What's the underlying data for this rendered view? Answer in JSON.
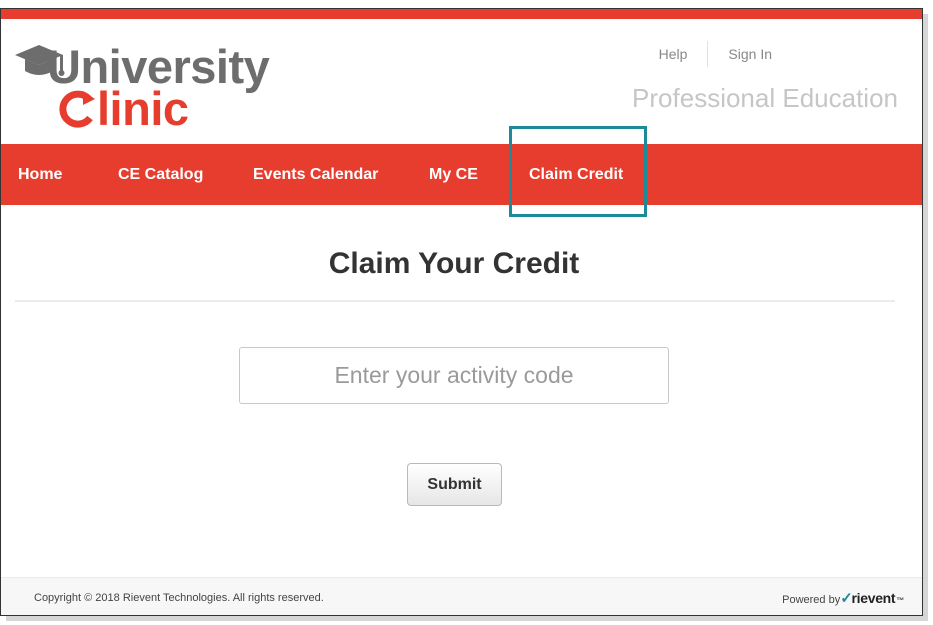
{
  "brand": {
    "logo_word1": "niversity",
    "logo_word2": "linic",
    "tagline": "Professional Education",
    "accent_color": "#e63d2f",
    "logo_gray": "#6d6d6d",
    "highlight_color": "#1c8b99"
  },
  "utility_nav": {
    "help": "Help",
    "sign_in": "Sign In"
  },
  "main_nav": {
    "items": [
      {
        "label": "Home"
      },
      {
        "label": "CE Catalog"
      },
      {
        "label": "Events Calendar"
      },
      {
        "label": "My CE"
      },
      {
        "label": "Claim Credit"
      }
    ],
    "highlighted_item": "Claim Credit"
  },
  "page": {
    "title": "Claim Your Credit",
    "code_input": {
      "value": "",
      "placeholder": "Enter your activity code"
    },
    "submit_label": "Submit"
  },
  "footer": {
    "copyright": "Copyright © 2018 Rievent Technologies. All rights reserved.",
    "powered_by": "Powered by",
    "powered_logo": "rievent",
    "trademark": "™"
  },
  "icons": {
    "logo_cap": "graduation-cap-icon",
    "logo_c": "refresh-arrow-c-icon",
    "rievent_mark": "checkmark-icon"
  }
}
